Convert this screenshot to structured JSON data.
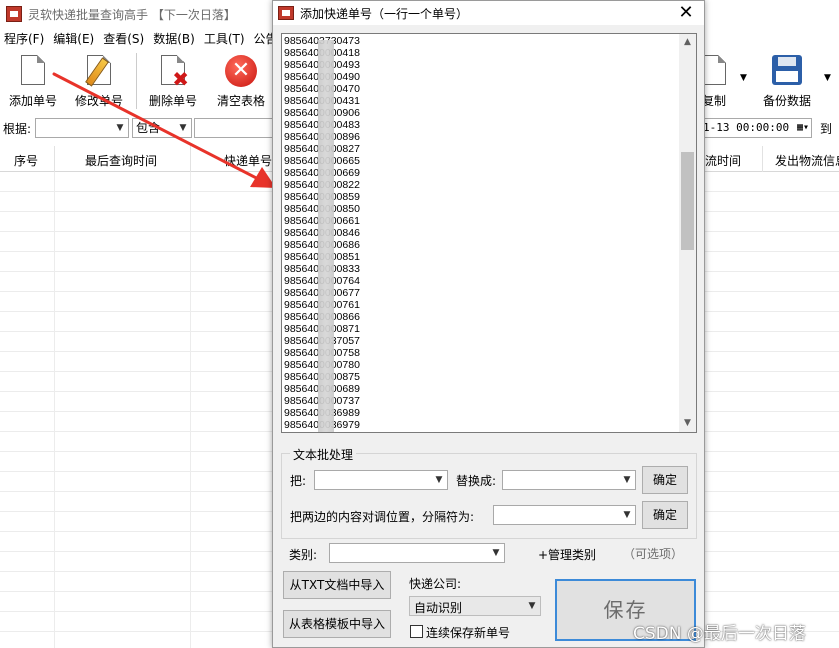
{
  "main_window": {
    "title": "灵软快递批量查询高手 【下一次日落】",
    "menu": [
      "程序(F)",
      "编辑(E)",
      "查看(S)",
      "数据(B)",
      "工具(T)",
      "公告("
    ],
    "toolbar": {
      "add": "添加单号",
      "edit": "修改单号",
      "delete": "删除单号",
      "clear": "清空表格",
      "copy": "复制",
      "backup": "备份数据"
    },
    "filter": {
      "basis_label": "根据:",
      "contains": "包含",
      "date_fragment": "1-13 00:00:00",
      "to_label": "到"
    },
    "columns": {
      "seq": "序号",
      "last_query_time": "最后查询时间",
      "tracking_no": "快递单号",
      "logistics_time": "流时间",
      "sender_info": "发出物流信息"
    }
  },
  "dialog": {
    "title": "添加快递单号（一行一个单号）",
    "tracking_numbers": [
      "9856403730473",
      "9856400000418",
      "9856400000493",
      "9856400000490",
      "9856400000470",
      "9856400000431",
      "9856400000906",
      "9856400000483",
      "9856400000896",
      "9856400000827",
      "9856400000665",
      "9856400000669",
      "9856400000822",
      "9856400000859",
      "9856400000850",
      "9856400000661",
      "9856400000846",
      "9856400000686",
      "9856400000851",
      "9856400000833",
      "9856400000764",
      "9856400000677",
      "9856400000761",
      "9856400000866",
      "9856400000871",
      "9856400037057",
      "9856400000758",
      "9856400000780",
      "9856400000875",
      "9856400000689",
      "9856400000737",
      "9856400036989",
      "9856400036979"
    ],
    "batch_group": {
      "legend": "文本批处理",
      "replace_from_label": "把:",
      "replace_to_label": "替换成:",
      "confirm": "确定",
      "swap_label": "把两边的内容对调位置，分隔符为:",
      "confirm2": "确定"
    },
    "category_label": "类别:",
    "manage_category": "+管理类别",
    "optional": "（可选项）",
    "import_txt": "从TXT文档中导入",
    "import_table": "从表格模板中导入",
    "courier_label": "快递公司:",
    "courier_value": "自动识别",
    "continuous_save": "连续保存新单号",
    "save": "保存"
  },
  "watermark": "CSDN @最后一次日落",
  "colors": {
    "arrow": "#e8332a",
    "save_border": "#3c8ad8",
    "dialog_bg": "#f0f0f0"
  }
}
